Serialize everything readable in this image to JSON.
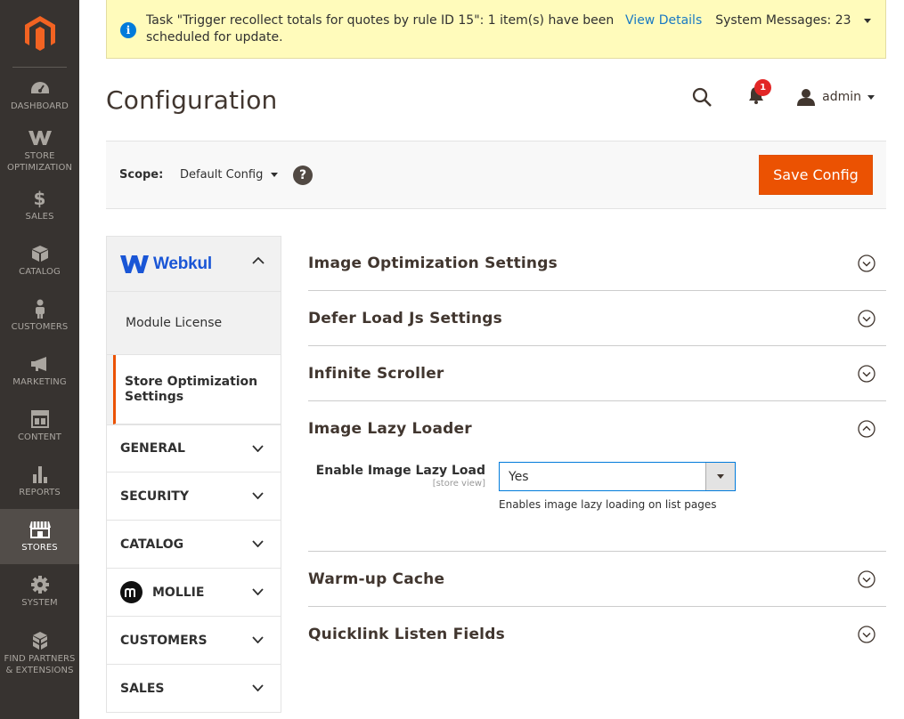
{
  "sidebar": {
    "items": [
      {
        "label": "DASHBOARD",
        "icon": "dashboard-icon"
      },
      {
        "label": "STORE OPTIMIZATION",
        "icon": "store-optimization-icon"
      },
      {
        "label": "SALES",
        "icon": "dollar-icon"
      },
      {
        "label": "CATALOG",
        "icon": "cube-icon"
      },
      {
        "label": "CUSTOMERS",
        "icon": "person-icon"
      },
      {
        "label": "MARKETING",
        "icon": "megaphone-icon"
      },
      {
        "label": "CONTENT",
        "icon": "content-layout-icon"
      },
      {
        "label": "REPORTS",
        "icon": "bar-chart-icon"
      },
      {
        "label": "STORES",
        "icon": "storefront-icon"
      },
      {
        "label": "SYSTEM",
        "icon": "gear-icon"
      },
      {
        "label": "FIND PARTNERS & EXTENSIONS",
        "icon": "boxes-icon"
      }
    ],
    "active": "STORES"
  },
  "message": {
    "text": "Task \"Trigger recollect totals for quotes by rule ID 15\": 1 item(s) have been scheduled for update.",
    "link": "View Details",
    "system_messages": "System Messages: 23"
  },
  "header": {
    "title": "Configuration",
    "notification_count": "1",
    "user": "admin"
  },
  "scope": {
    "label": "Scope:",
    "value": "Default Config",
    "help": "?",
    "save_label": "Save Config"
  },
  "config_nav": {
    "vendor": "Webkul",
    "vendor_items": [
      "Module License",
      "Store Optimization Settings"
    ],
    "sections": [
      "GENERAL",
      "SECURITY",
      "CATALOG",
      "MOLLIE",
      "CUSTOMERS",
      "SALES"
    ]
  },
  "main": {
    "sections": [
      "Image Optimization Settings",
      "Defer Load Js Settings",
      "Infinite Scroller",
      "Image Lazy Loader",
      "Warm-up Cache",
      "Quicklink Listen Fields"
    ],
    "field": {
      "label": "Enable Image Lazy Load",
      "scope": "[store view]",
      "value": "Yes",
      "note": "Enables image lazy loading on list pages"
    }
  },
  "colors": {
    "sidebar": "#373330",
    "accent": "#eb5202",
    "link": "#1979c3",
    "message_bg": "#fffbbb"
  }
}
